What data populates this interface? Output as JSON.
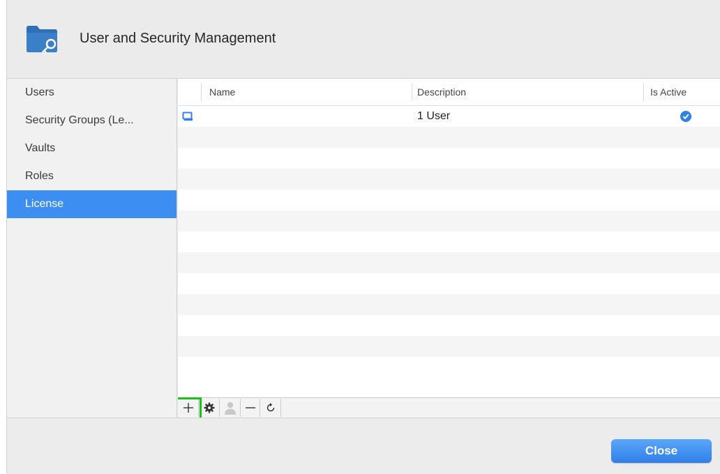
{
  "window": {
    "title": "User and Security Management"
  },
  "sidebar": {
    "items": [
      {
        "label": "Users",
        "active": false
      },
      {
        "label": "Security Groups (Le...",
        "active": false
      },
      {
        "label": "Vaults",
        "active": false
      },
      {
        "label": "Roles",
        "active": false
      },
      {
        "label": "License",
        "active": true
      }
    ]
  },
  "table": {
    "columns": [
      "Name",
      "Description",
      "Is Active"
    ],
    "rows": [
      {
        "name": "",
        "description": "1 User",
        "is_active": true
      }
    ]
  },
  "toolbar": {
    "buttons": [
      {
        "icon": "plus-icon",
        "highlighted": true
      },
      {
        "icon": "gear-icon",
        "highlighted": false
      },
      {
        "icon": "user-icon",
        "highlighted": false,
        "disabled": true
      },
      {
        "icon": "minus-icon",
        "highlighted": false
      },
      {
        "icon": "refresh-icon",
        "highlighted": false
      }
    ]
  },
  "footer": {
    "close_label": "Close"
  },
  "colors": {
    "accent": "#3c8ef0",
    "highlight": "#16c316",
    "folder": "#2f6fb5"
  }
}
